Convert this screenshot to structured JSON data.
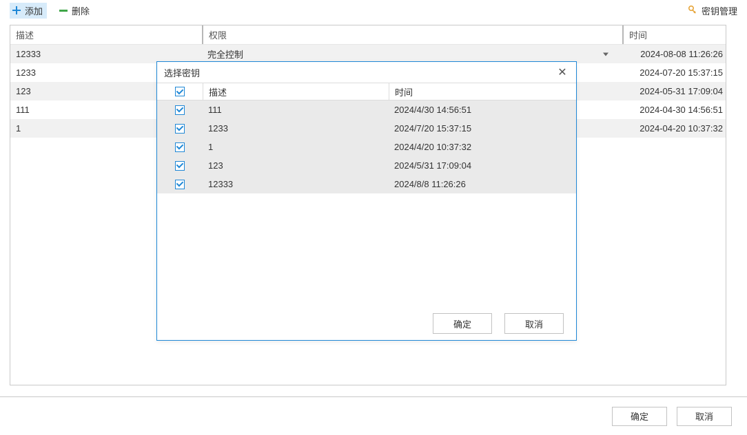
{
  "toolbar": {
    "add_label": "添加",
    "delete_label": "删除",
    "key_mgmt_label": "密钥管理"
  },
  "main_table": {
    "headers": {
      "desc": "描述",
      "perm": "权限",
      "time": "时间"
    },
    "rows": [
      {
        "desc": "12333",
        "perm": "完全控制",
        "time": "2024-08-08 11:26:26",
        "has_dropdown": true
      },
      {
        "desc": "1233",
        "perm": "",
        "time": "2024-07-20 15:37:15"
      },
      {
        "desc": "123",
        "perm": "",
        "time": "2024-05-31 17:09:04"
      },
      {
        "desc": "111",
        "perm": "",
        "time": "2024-04-30 14:56:51"
      },
      {
        "desc": "1",
        "perm": "",
        "time": "2024-04-20 10:37:32"
      }
    ]
  },
  "dialog": {
    "title": "选择密钥",
    "headers": {
      "desc": "描述",
      "time": "时间"
    },
    "rows": [
      {
        "checked": true,
        "desc": "111",
        "time": "2024/4/30 14:56:51"
      },
      {
        "checked": true,
        "desc": "1233",
        "time": "2024/7/20 15:37:15"
      },
      {
        "checked": true,
        "desc": "1",
        "time": "2024/4/20 10:37:32"
      },
      {
        "checked": true,
        "desc": "123",
        "time": "2024/5/31 17:09:04"
      },
      {
        "checked": true,
        "desc": "12333",
        "time": "2024/8/8 11:26:26"
      }
    ],
    "ok_label": "确定",
    "cancel_label": "取消"
  },
  "footer": {
    "ok_label": "确定",
    "cancel_label": "取消"
  }
}
